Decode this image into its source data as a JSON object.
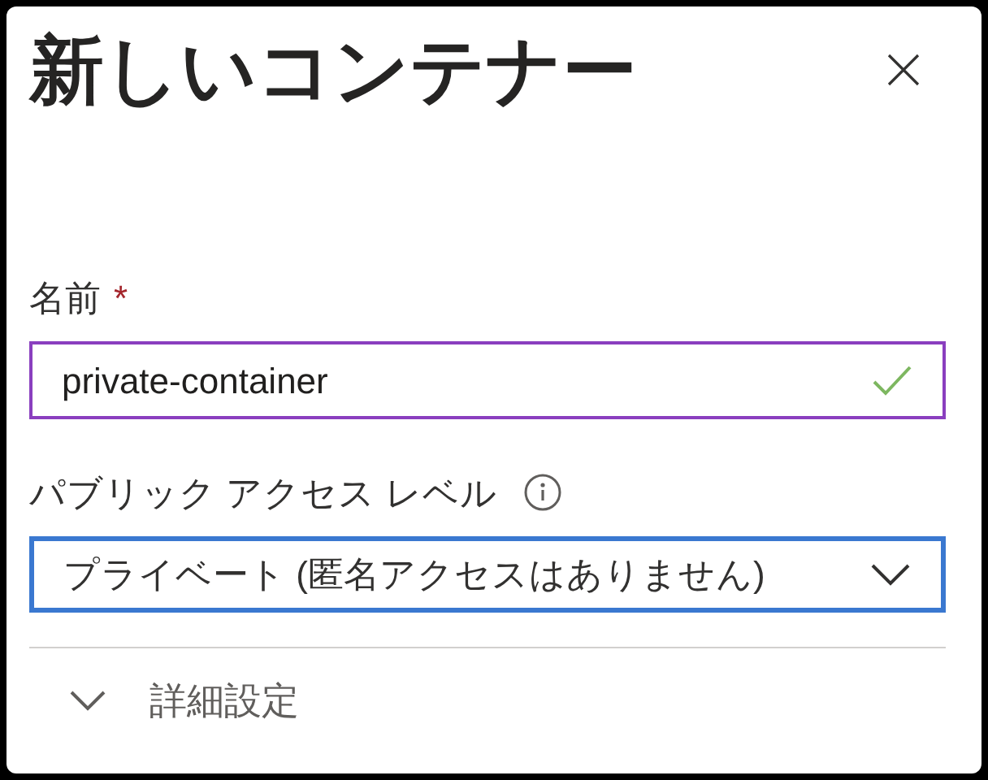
{
  "panel": {
    "title": "新しいコンテナー"
  },
  "name_field": {
    "label": "名前",
    "required_mark": "*",
    "value": "private-container",
    "valid": true
  },
  "access_field": {
    "label": "パブリック アクセス レベル",
    "value": "プライベート (匿名アクセスはありません)",
    "focused": true
  },
  "advanced": {
    "label": "詳細設定",
    "expanded": false
  }
}
